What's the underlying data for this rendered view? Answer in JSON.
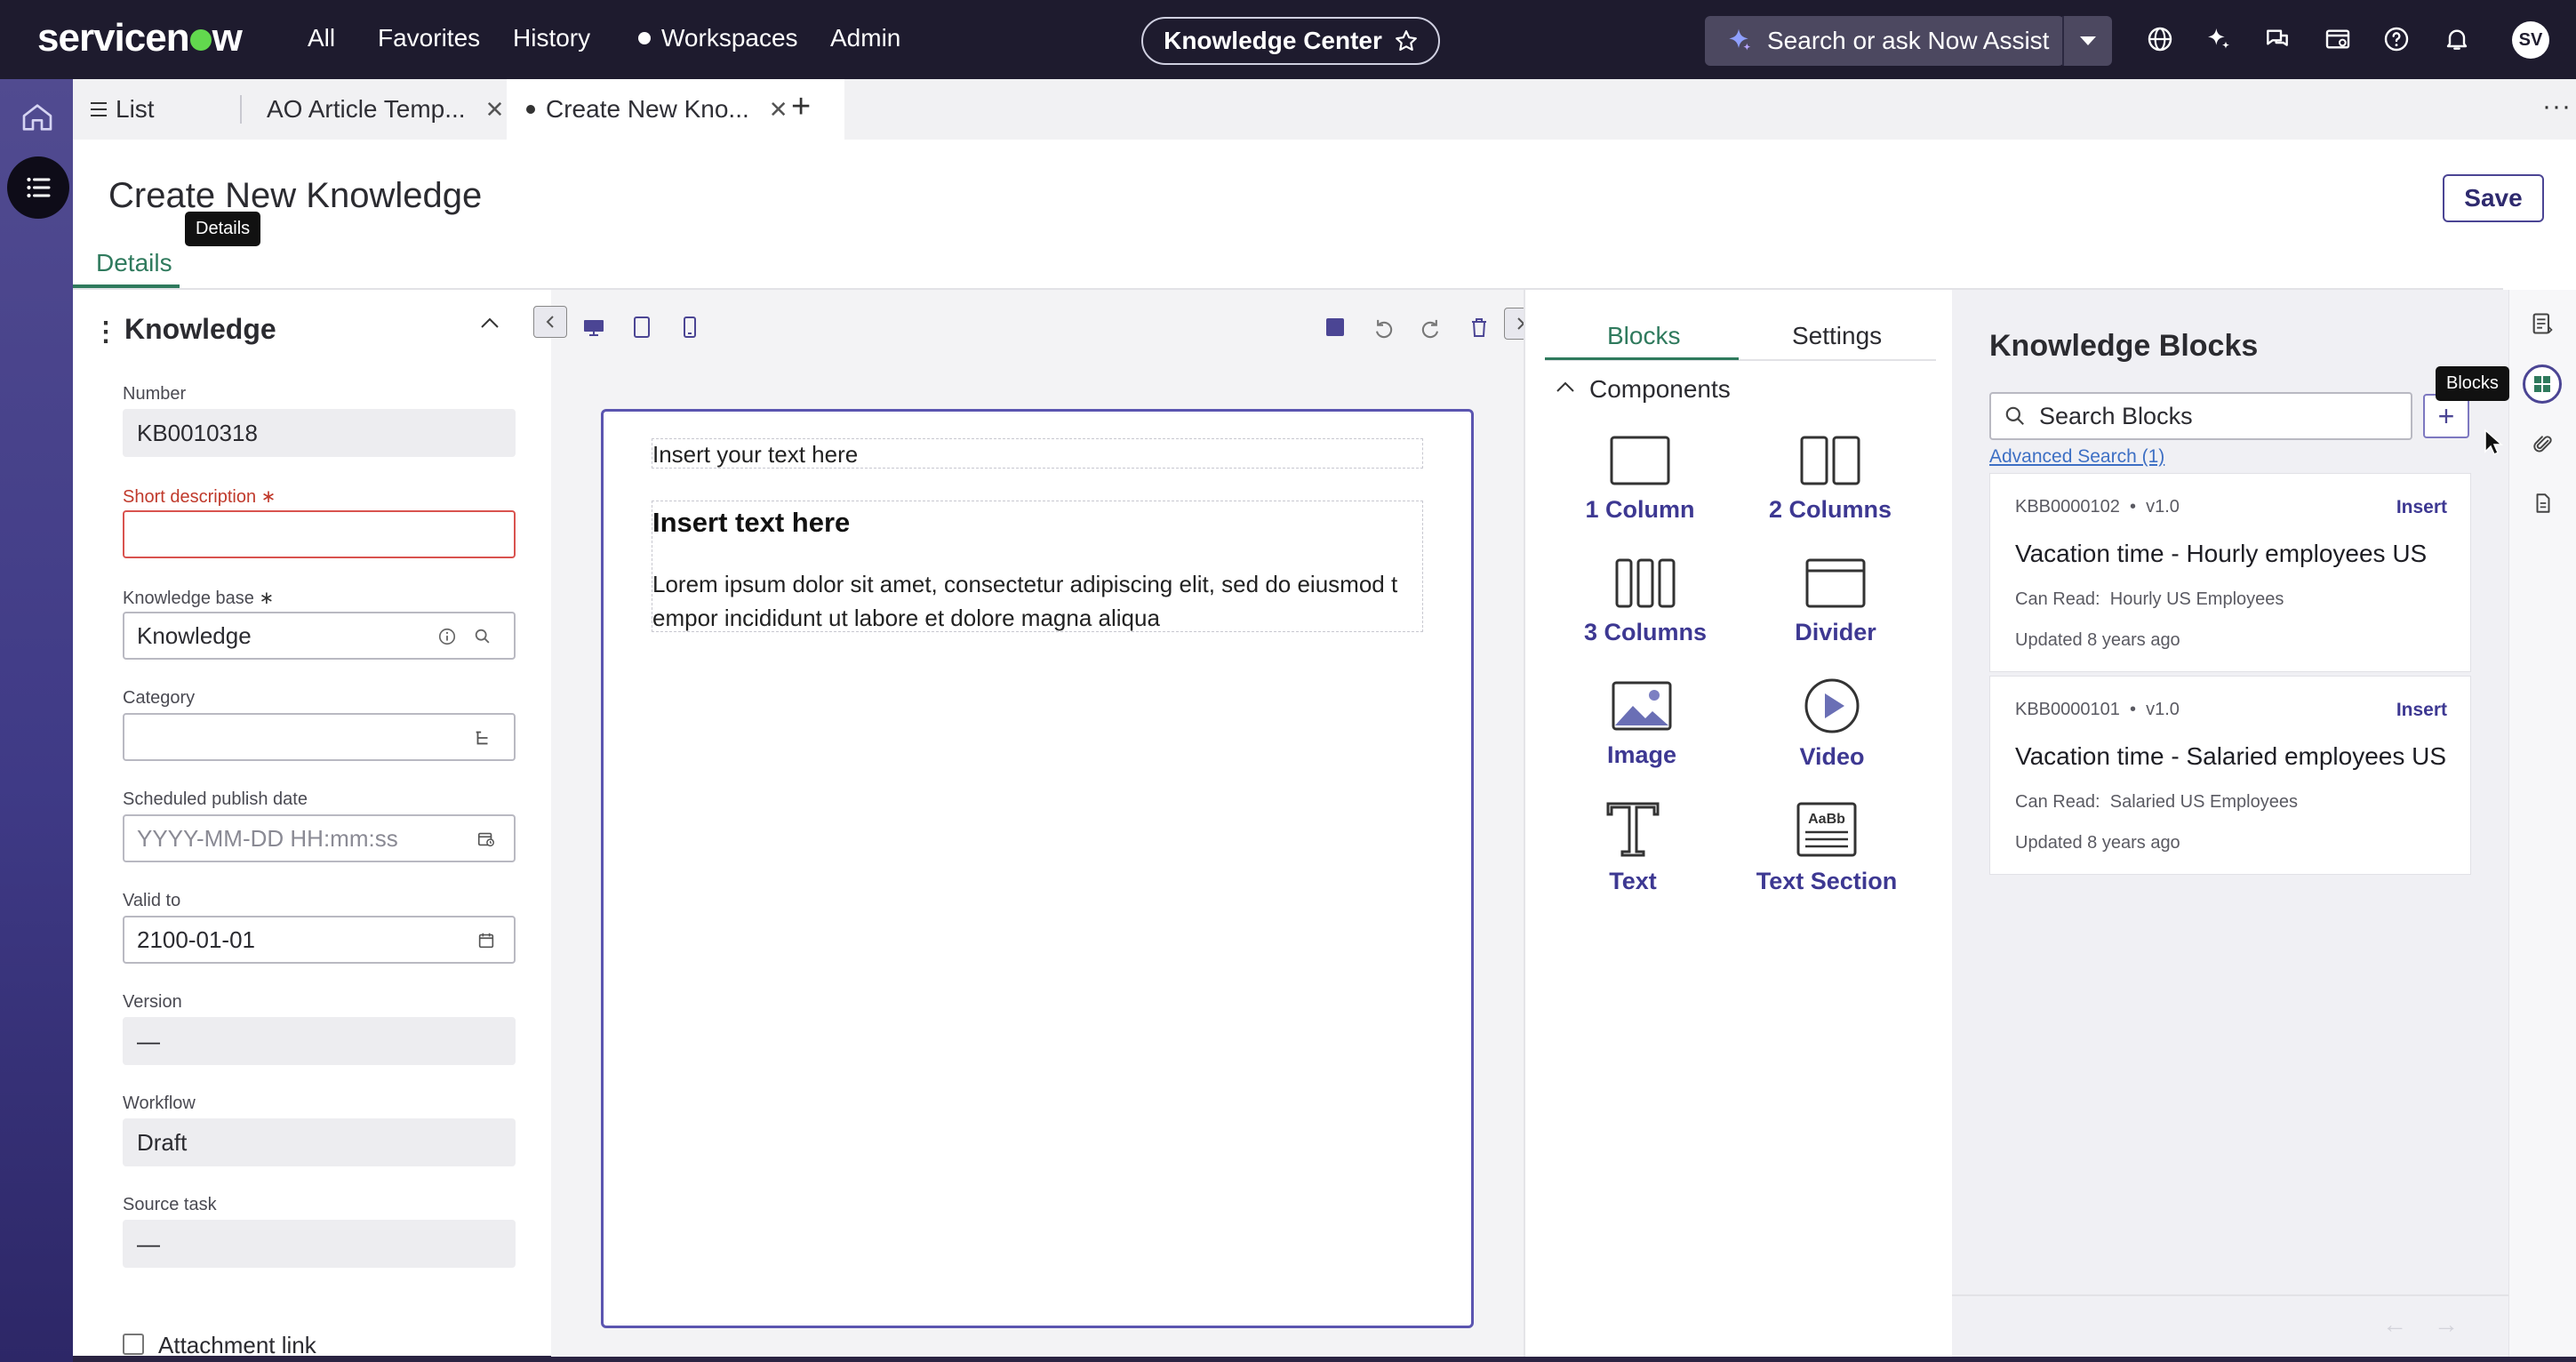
{
  "topnav": {
    "brand": "servicenow",
    "links": [
      "All",
      "Favorites",
      "History",
      "Workspaces",
      "Admin"
    ],
    "app_pill": "Knowledge Center",
    "search_label": "Search or ask Now Assist",
    "avatar_initials": "SV",
    "colors": {
      "bar": "#1e1b2e",
      "brand_dot": "#62d84e"
    }
  },
  "tabs": [
    {
      "label": "List"
    },
    {
      "label": "AO Article Temp..."
    },
    {
      "label": "Create New Kno..."
    }
  ],
  "header": {
    "title": "Create New Knowledge",
    "tooltip": "Details",
    "save_label": "Save",
    "details_tab": "Details"
  },
  "form": {
    "section_title": "Knowledge",
    "fields": {
      "number": {
        "label": "Number",
        "value": "KB0010318"
      },
      "short_description": {
        "label": "Short description",
        "value": ""
      },
      "knowledge_base": {
        "label": "Knowledge base",
        "value": "Knowledge"
      },
      "category": {
        "label": "Category",
        "value": ""
      },
      "publish_date": {
        "label": "Scheduled publish date",
        "placeholder": "YYYY-MM-DD HH:mm:ss"
      },
      "valid_to": {
        "label": "Valid to",
        "value": "2100-01-01"
      },
      "version": {
        "label": "Version",
        "value": "—"
      },
      "workflow": {
        "label": "Workflow",
        "value": "Draft"
      },
      "source_task": {
        "label": "Source task",
        "value": "—"
      },
      "attachment_link": {
        "label": "Attachment link"
      }
    }
  },
  "canvas": {
    "placeholder_line": "Insert your text here",
    "heading": "Insert text here",
    "paragraph_line1": "Lorem ipsum dolor sit amet, consectetur adipiscing elit, sed do eiusmod t",
    "paragraph_line2": "empor incididunt ut labore et dolore magna aliqua"
  },
  "blocks_panel": {
    "tabs": [
      "Blocks",
      "Settings"
    ],
    "section": "Components",
    "components": [
      "1 Column",
      "2 Columns",
      "3 Columns",
      "Divider",
      "Image",
      "Video",
      "Text",
      "Text Section"
    ]
  },
  "kb_panel": {
    "title": "Knowledge Blocks",
    "search_placeholder": "Search Blocks",
    "advanced_search": "Advanced Search (1)",
    "tooltip": "Blocks",
    "insert_label": "Insert",
    "cards": [
      {
        "id": "KBB0000102",
        "version": "v1.0",
        "title": "Vacation time - Hourly employees US",
        "can_read_label": "Can Read:",
        "can_read": "Hourly US Employees",
        "updated": "Updated 8 years ago"
      },
      {
        "id": "KBB0000101",
        "version": "v1.0",
        "title": "Vacation time - Salaried employees US",
        "can_read_label": "Can Read:",
        "can_read": "Salaried US Employees",
        "updated": "Updated 8 years ago"
      }
    ]
  },
  "accent_colors": {
    "primary": "#4b4594",
    "green": "#2f7a5d",
    "required": "#c0392b"
  }
}
